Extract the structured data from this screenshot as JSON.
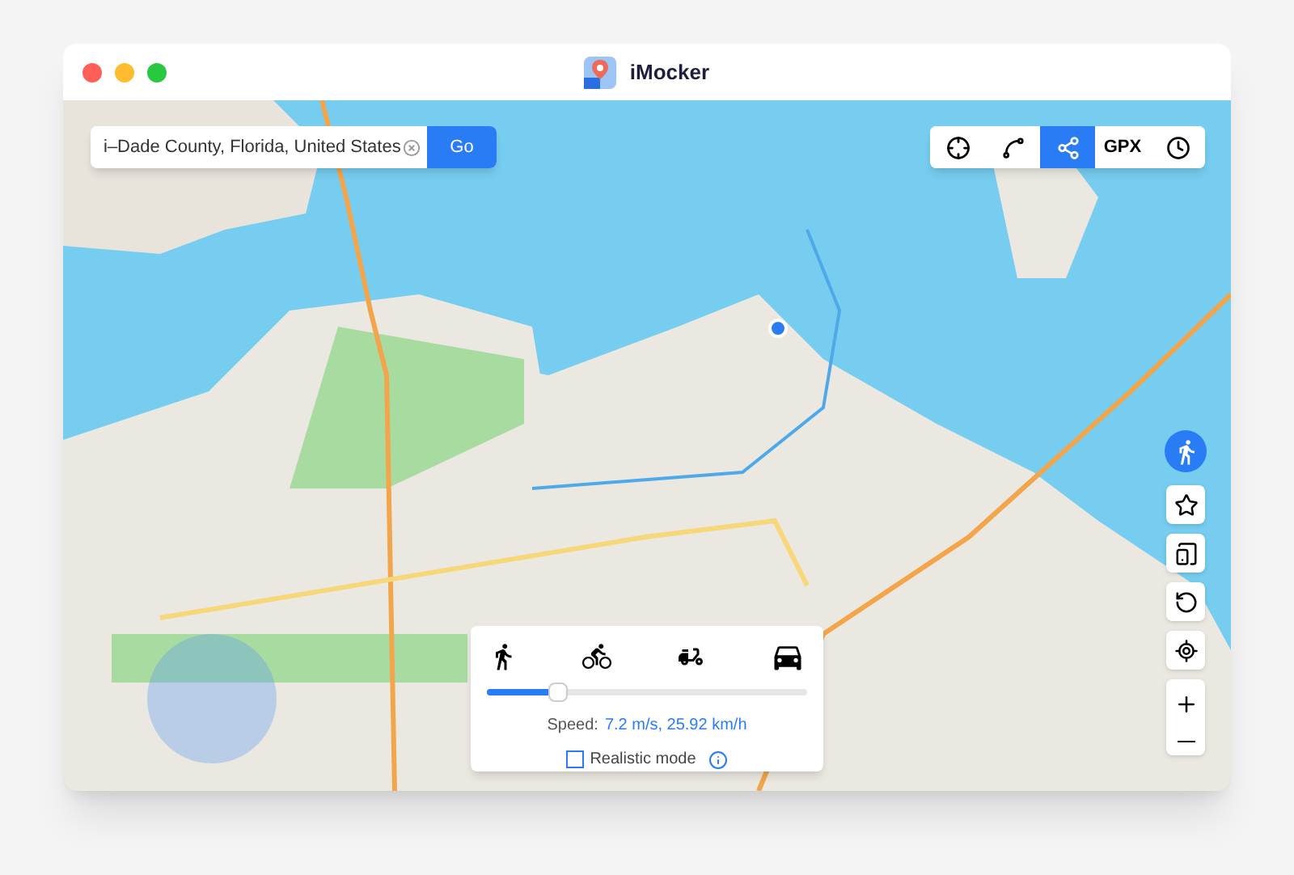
{
  "window": {
    "title": "iMocker"
  },
  "search": {
    "value": "i–Dade County, Florida, United States",
    "button": "Go"
  },
  "toolbar": [
    {
      "kind": "crosshair",
      "selected": false
    },
    {
      "kind": "route",
      "selected": false
    },
    {
      "kind": "share",
      "selected": true
    },
    {
      "kind": "text",
      "label": "GPX",
      "selected": false
    },
    {
      "kind": "clock",
      "selected": false
    }
  ],
  "side_buttons": [
    {
      "kind": "star"
    },
    {
      "kind": "devices"
    },
    {
      "kind": "reset"
    },
    {
      "kind": "locate"
    }
  ],
  "speed_panel": {
    "modes": [
      {
        "kind": "walk"
      },
      {
        "kind": "bike"
      },
      {
        "kind": "scooter"
      },
      {
        "kind": "car"
      }
    ],
    "level": 0.22,
    "speed_label": "Speed:",
    "speed_value": "7.2 m/s, 25.92 km/h",
    "realistic_mode": {
      "label": "Realistic mode",
      "checked": false
    }
  }
}
